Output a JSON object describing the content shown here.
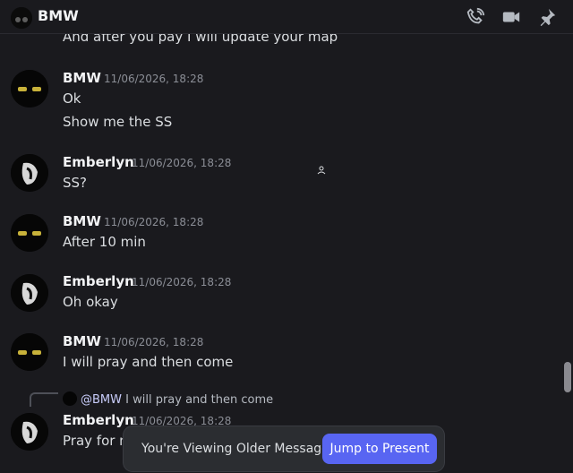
{
  "header": {
    "title": "BMW"
  },
  "messages": {
    "partial_top": "And after you pay I will update your map",
    "m1": {
      "author": "BMW",
      "time": "11/06/2026, 18:28",
      "lines": [
        "Ok",
        "Show me the SS"
      ]
    },
    "m2": {
      "author": "Emberlyn",
      "time": "11/06/2026, 18:28",
      "lines": [
        "SS?"
      ]
    },
    "m3": {
      "author": "BMW",
      "time": "11/06/2026, 18:28",
      "lines": [
        "After 10 min"
      ]
    },
    "m4": {
      "author": "Emberlyn",
      "time": "11/06/2026, 18:28",
      "lines": [
        "Oh okay"
      ]
    },
    "m5": {
      "author": "BMW",
      "time": "11/06/2026, 18:28",
      "lines": [
        "I will pray and then come"
      ]
    },
    "m6": {
      "reply_to": "@BMW",
      "reply_text": "I will pray and then come",
      "author": "Emberlyn",
      "time": "11/06/2026, 18:28",
      "lines": [
        "Pray for m"
      ]
    }
  },
  "banner": {
    "text": "You're Viewing Older Messages",
    "button": "Jump to Present"
  },
  "icons": [
    "phone-icon",
    "video-icon",
    "pin-icon",
    "person-small-icon"
  ]
}
